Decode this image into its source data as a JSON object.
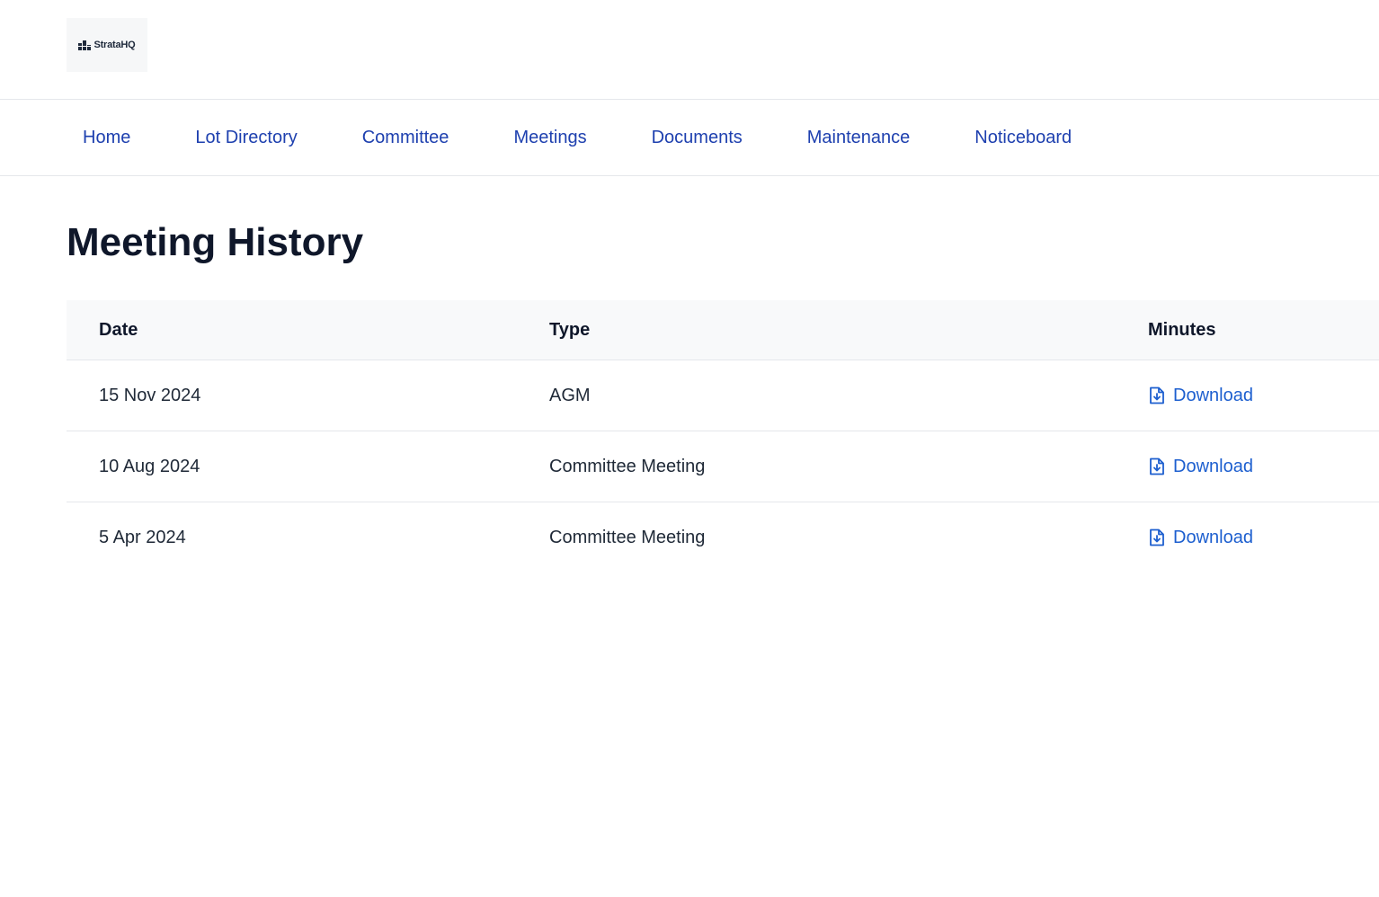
{
  "brand": {
    "name": "StrataHQ",
    "logo_icon": "building-blocks-icon"
  },
  "nav": {
    "items": [
      {
        "label": "Home"
      },
      {
        "label": "Lot Directory"
      },
      {
        "label": "Committee"
      },
      {
        "label": "Meetings"
      },
      {
        "label": "Documents"
      },
      {
        "label": "Maintenance"
      },
      {
        "label": "Noticeboard"
      }
    ]
  },
  "page": {
    "title": "Meeting History"
  },
  "table": {
    "headers": {
      "date": "Date",
      "type": "Type",
      "minutes": "Minutes"
    },
    "rows": [
      {
        "date": "15 Nov 2024",
        "type": "AGM",
        "minutes": "Download",
        "icon": "file-download-icon"
      },
      {
        "date": "10 Aug 2024",
        "type": "Committee Meeting",
        "minutes": "Download",
        "icon": "file-download-icon"
      },
      {
        "date": "5 Apr 2024",
        "type": "Committee Meeting",
        "minutes": "Download",
        "icon": "file-download-icon"
      }
    ]
  },
  "colors": {
    "nav_link": "#1e40af",
    "download_link": "#1d5fcf",
    "title": "#0f172a",
    "table_header_bg": "#f8f9fa",
    "divider": "#e5e7eb"
  }
}
